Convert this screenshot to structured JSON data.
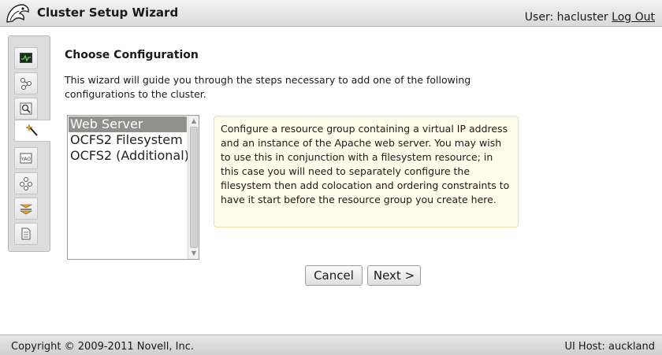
{
  "header": {
    "title": "Cluster Setup Wizard",
    "user_label": "User: hacluster",
    "logout_label": "Log Out"
  },
  "sidebar": {
    "items": [
      {
        "icon": "monitor-icon",
        "active": false
      },
      {
        "icon": "network-icon",
        "active": false
      },
      {
        "icon": "magnifier-icon",
        "active": false
      },
      {
        "icon": "wand-icon",
        "active": true
      },
      {
        "icon": "config-list-icon",
        "active": false
      },
      {
        "icon": "nodes-icon",
        "active": false
      },
      {
        "icon": "layers-icon",
        "active": false
      },
      {
        "icon": "document-icon",
        "active": false
      }
    ]
  },
  "main": {
    "title": "Choose Configuration",
    "intro": "This wizard will guide you through the steps necessary to add one of the following configurations to the cluster.",
    "options": [
      "Web Server",
      "OCFS2 Filesystem",
      "OCFS2 (Additional)"
    ],
    "selected_option": "Web Server",
    "description": "Configure a resource group containing a virtual IP address and an instance of the Apache web server. You may wish to use this in conjunction with a filesystem resource; in this case you will need to separately configure the filesystem then add colocation and ordering constraints to have it start before the resource group you create here.",
    "cancel_label": "Cancel",
    "next_label": "Next >"
  },
  "footer": {
    "copyright": "Copyright © 2009-2011 Novell, Inc.",
    "ui_host": "UI Host: auckland"
  },
  "colors": {
    "selection": "#8f918d",
    "description_bg": "#fffceb",
    "description_border": "#f1dfa0"
  }
}
